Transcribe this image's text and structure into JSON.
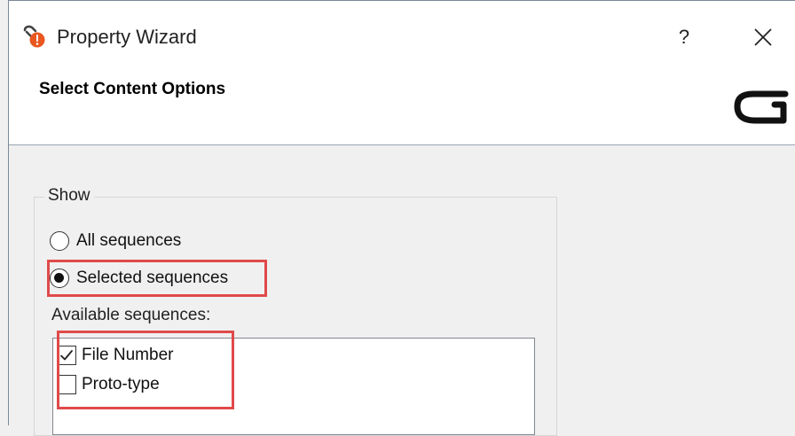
{
  "window": {
    "title": "Property Wizard",
    "help_label": "?",
    "header": {
      "step_title": "Select Content Options"
    }
  },
  "show_group": {
    "label": "Show",
    "options": [
      {
        "label": "All sequences",
        "checked": false
      },
      {
        "label": "Selected sequences",
        "checked": true
      }
    ],
    "available_label": "Available sequences:",
    "sequences": [
      {
        "label": "File Number",
        "checked": true
      },
      {
        "label": "Proto-type",
        "checked": false
      }
    ]
  },
  "icons": {
    "app": "wizard-app-icon",
    "help": "question-mark",
    "close": "close-x-icon",
    "logo": "brand-logo-icon",
    "check": "checkmark-icon"
  },
  "colors": {
    "highlight": "#e04a4a",
    "app_icon_accent": "#e8571f",
    "header_bg": "#ffffff",
    "dialog_bg": "#f0f0f0"
  }
}
